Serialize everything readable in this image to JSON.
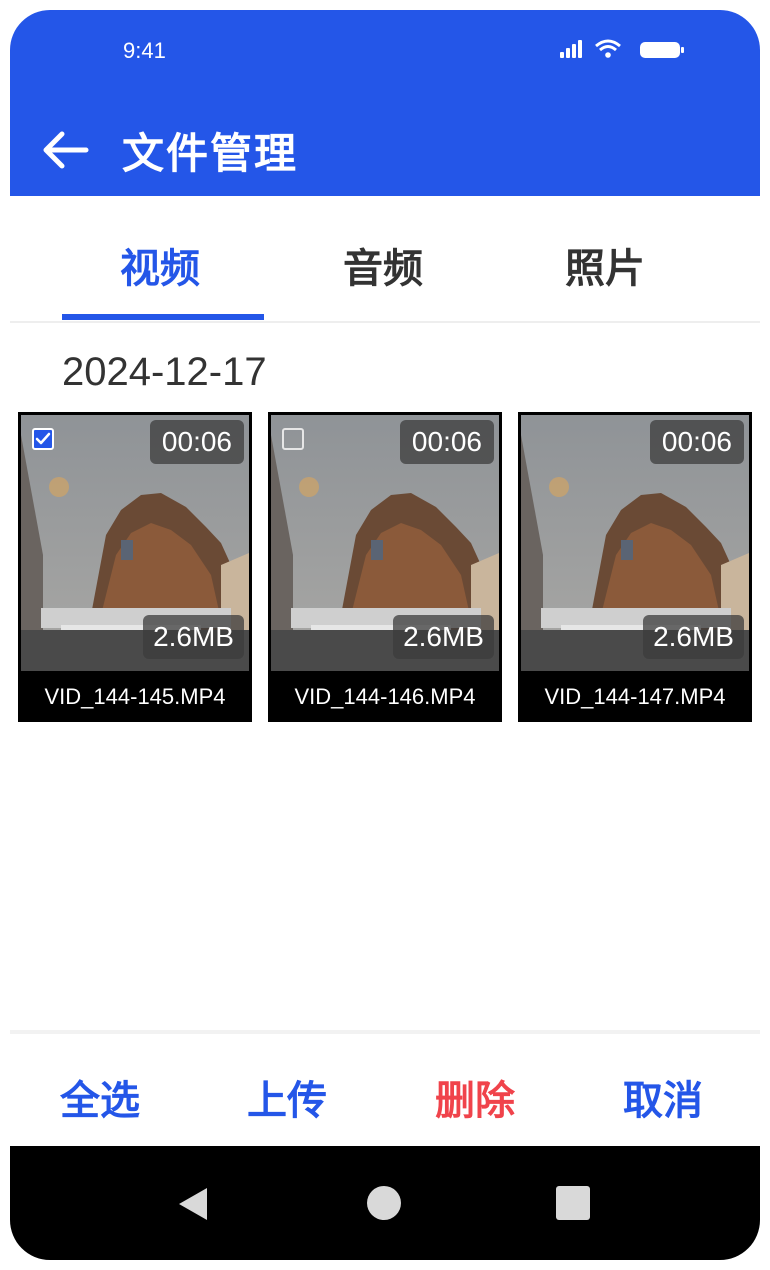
{
  "status_bar": {
    "time": "9:41"
  },
  "header": {
    "title": "文件管理"
  },
  "tabs": [
    {
      "label": "视频",
      "active": true
    },
    {
      "label": "音频",
      "active": false
    },
    {
      "label": "照片",
      "active": false
    }
  ],
  "section": {
    "date": "2024-12-17"
  },
  "videos": [
    {
      "filename": "VID_144-145.MP4",
      "duration": "00:06",
      "size": "2.6MB",
      "selected": true
    },
    {
      "filename": "VID_144-146.MP4",
      "duration": "00:06",
      "size": "2.6MB",
      "selected": false
    },
    {
      "filename": "VID_144-147.MP4",
      "duration": "00:06",
      "size": "2.6MB",
      "selected": false
    }
  ],
  "actions": {
    "select_all": "全选",
    "upload": "上传",
    "delete": "删除",
    "cancel": "取消"
  },
  "colors": {
    "primary": "#2456E8",
    "danger": "#F0434B"
  }
}
